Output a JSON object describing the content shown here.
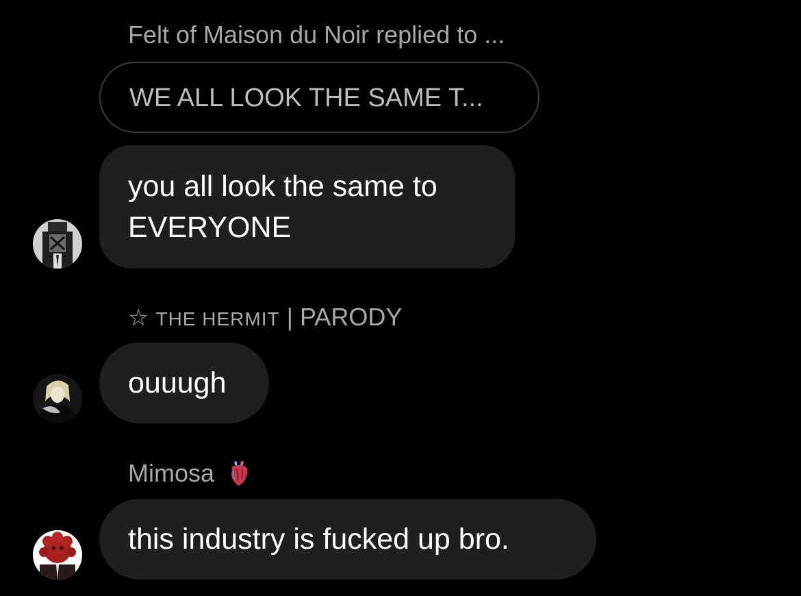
{
  "reply": {
    "header": "Felt of Maison du Noir replied to ...",
    "quoted_text": "WE ALL LOOK THE SAME T..."
  },
  "messages": [
    {
      "text_line1": "you all look the same to",
      "text_line2": "EVERYONE",
      "avatar_icon": "masked-figure-avatar"
    },
    {
      "sender_prefix": "THE HERMIT",
      "sender_suffix": "| PARODY",
      "sender_icon": "star-outline-icon",
      "text": "ouuugh",
      "avatar_icon": "blond-character-avatar"
    },
    {
      "sender": "Mimosa",
      "sender_icon": "anatomical-heart-icon",
      "text": "this industry is fucked up bro.",
      "avatar_icon": "red-flower-head-avatar"
    }
  ],
  "colors": {
    "background": "#000000",
    "bubble": "#1f1f1f",
    "meta_text": "#a8a8a8",
    "message_text": "#ffffff",
    "quote_border": "#3a3a3a"
  }
}
